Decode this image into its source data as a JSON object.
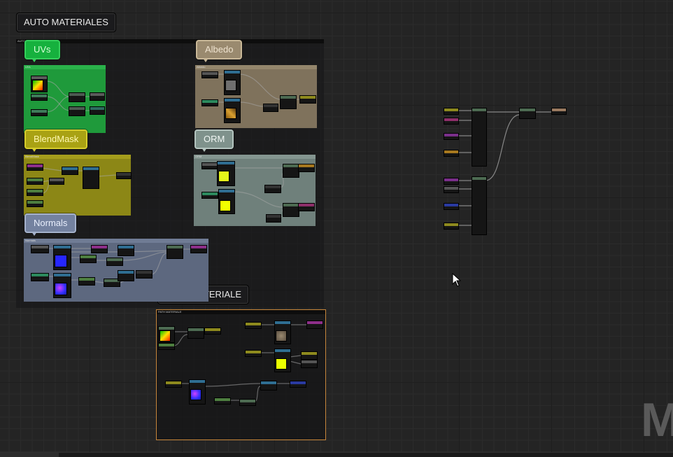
{
  "graph": {
    "auto_section": {
      "title": "AUTO MATERIALES",
      "header_label": "AUTO MATERIALES"
    },
    "path_section": {
      "title": "PATH MATERIALE",
      "header_label": "PATH MATERIALE"
    },
    "groups": {
      "uvs": {
        "label": "UVs",
        "header": "UVs",
        "color": "#1f9a3b"
      },
      "albedo": {
        "label": "Albedo",
        "header": "Albedo",
        "color": "#7f725c"
      },
      "blendmask": {
        "label": "BlendMask",
        "header": "BlendMask",
        "color": "#8c8716"
      },
      "orm": {
        "label": "ORM",
        "header": "ORM",
        "color": "#6f807b"
      },
      "normals": {
        "label": "Normals",
        "header": "Normals",
        "color": "#5d687f"
      }
    },
    "watermark": "M"
  }
}
